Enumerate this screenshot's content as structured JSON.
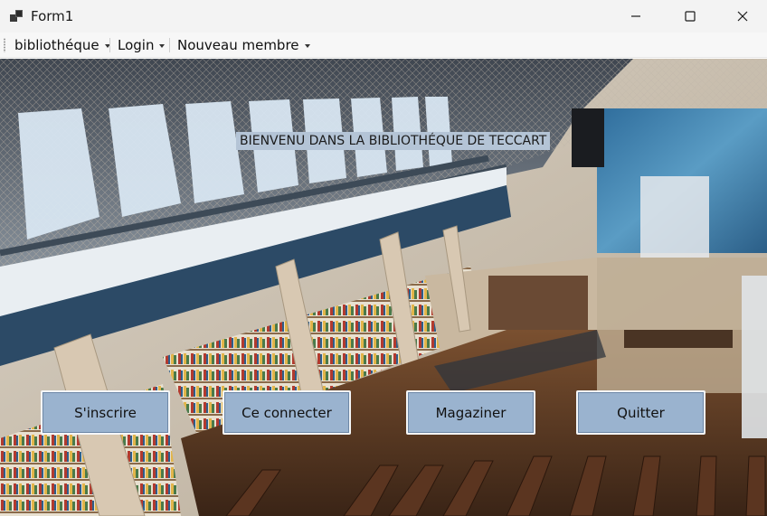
{
  "window": {
    "title": "Form1",
    "icon": "windows-forms-app-icon"
  },
  "titlebar_buttons": {
    "minimize": "minimize-icon",
    "maximize": "maximize-icon",
    "close": "close-icon"
  },
  "menu": {
    "items": [
      {
        "label": "bibliothéque"
      },
      {
        "label": "Login"
      },
      {
        "label": "Nouveau membre"
      }
    ]
  },
  "main": {
    "welcome_text": "BIENVENU DANS LA BIBLIOTHÉQUE DE TECCART",
    "buttons": {
      "register": "S'inscrire",
      "connect": "Ce connecter",
      "store": "Magaziner",
      "quit": "Quitter"
    }
  },
  "colors": {
    "button_fill": "#9ab3cf",
    "label_fill": "#b4c4d6",
    "titlebar": "#f3f3f3"
  }
}
